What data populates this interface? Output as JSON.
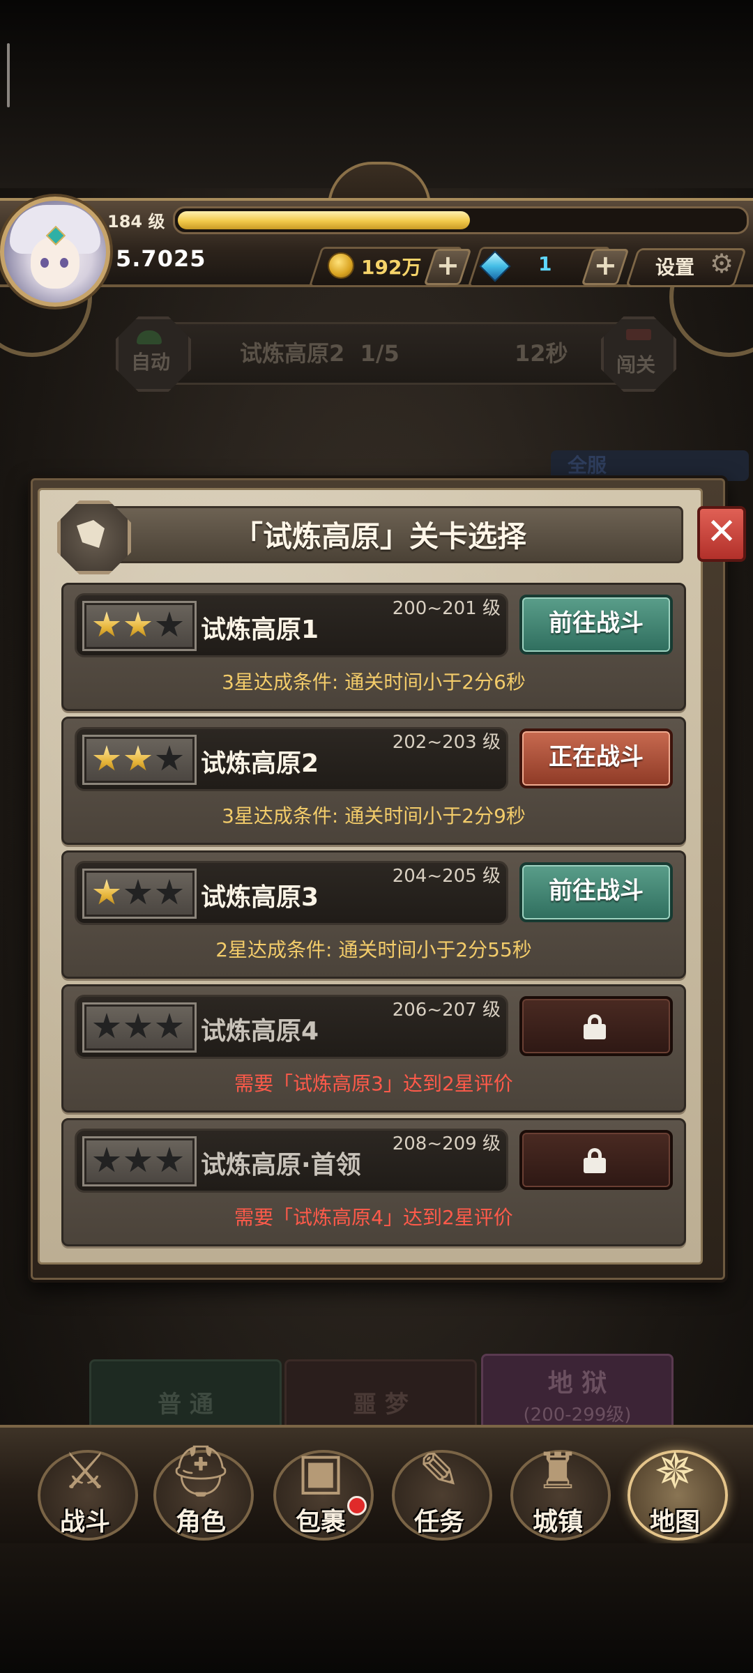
{
  "header": {
    "level": "184 级",
    "xp_fraction": 0.52,
    "power": "5.7025",
    "gold": "192万",
    "gems": "1",
    "settings_label": "设置"
  },
  "battle_strip": {
    "auto_label": "自动",
    "stage": "试炼高原2  1/5",
    "timer": "12秒",
    "challenge_label": "闯关",
    "ghost_banner": "全服"
  },
  "modal": {
    "title": "「试炼高原」关卡选择",
    "close_symbol": "✕",
    "stages": [
      {
        "name": "试炼高原1",
        "level_range": "200~201 级",
        "stars": 2,
        "button": "前往战斗",
        "state": "go",
        "condition": "3星达成条件:  通关时间小于2分6秒"
      },
      {
        "name": "试炼高原2",
        "level_range": "202~203 级",
        "stars": 2,
        "button": "正在战斗",
        "state": "active",
        "condition": "3星达成条件:  通关时间小于2分9秒"
      },
      {
        "name": "试炼高原3",
        "level_range": "204~205 级",
        "stars": 1,
        "button": "前往战斗",
        "state": "go",
        "condition": "2星达成条件:  通关时间小于2分55秒"
      },
      {
        "name": "试炼高原4",
        "level_range": "206~207 级",
        "stars": 0,
        "button": "",
        "state": "locked",
        "condition": "需要「试炼高原3」达到2星评价"
      },
      {
        "name": "试炼高原·首领",
        "level_range": "208~209 级",
        "stars": 0,
        "button": "",
        "state": "locked",
        "condition": "需要「试炼高原4」达到2星评价"
      }
    ]
  },
  "difficulty_tabs": {
    "normal": "普 通",
    "nightmare": "噩 梦",
    "hell": "地 狱",
    "hell_range": "(200-299级)"
  },
  "nav": [
    {
      "label": "战斗",
      "icon": "battle-shield-icon",
      "glyph": "⚔"
    },
    {
      "label": "角色",
      "icon": "helmet-icon",
      "glyph": "⛑"
    },
    {
      "label": "包裹",
      "icon": "backpack-icon",
      "glyph": "▣"
    },
    {
      "label": "任务",
      "icon": "quest-scroll-icon",
      "glyph": "✎"
    },
    {
      "label": "城镇",
      "icon": "castle-tower-icon",
      "glyph": "♜"
    },
    {
      "label": "地图",
      "icon": "map-icon",
      "glyph": "✵"
    }
  ],
  "colors": {
    "gold": "#f5d36a",
    "gem": "#5fd8ff",
    "go_button": "#2f6e5e",
    "active_button": "#8e3a26",
    "condition_text": "#f3cc6a",
    "requirement_text": "#ff5a4a"
  }
}
